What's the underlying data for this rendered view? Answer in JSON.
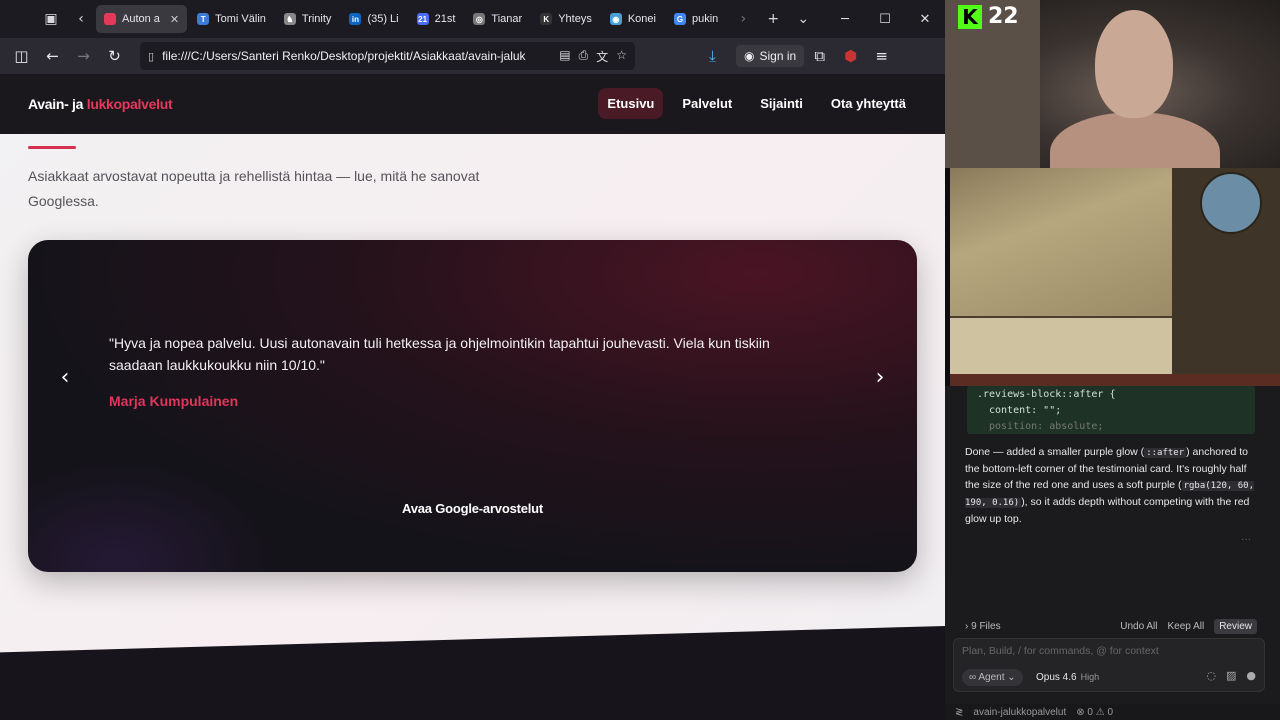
{
  "browser": {
    "tabs": [
      {
        "label": "Auton a",
        "color": "#e33a5c",
        "active": true
      },
      {
        "label": "Tomi Välin",
        "color": "#3a7bd5"
      },
      {
        "label": "Trinity",
        "color": "#888888"
      },
      {
        "label": "(35) Li",
        "color": "#0a66c2"
      },
      {
        "label": "21st",
        "color": "#4a6cf7"
      },
      {
        "label": "Tianar",
        "color": "#777777"
      },
      {
        "label": "Yhteys",
        "color": "#333333"
      },
      {
        "label": "Konei",
        "color": "#4a9fd8"
      },
      {
        "label": "pukin",
        "color": "#4285f4"
      }
    ],
    "tab_favicons": [
      "",
      "T",
      "♞",
      "in",
      "21",
      "◎",
      "K",
      "◉",
      "G"
    ],
    "url": "file:///C:/Users/Santeri Renko/Desktop/projektit/Asiakkaat/avain-jaluk",
    "sign_in": "Sign in"
  },
  "site": {
    "logo_prefix": "Avain- ja ",
    "logo_accent": "lukkopalvelut",
    "nav": [
      {
        "label": "Etusivu",
        "active": true
      },
      {
        "label": "Palvelut"
      },
      {
        "label": "Sijainti"
      },
      {
        "label": "Ota yhteyttä"
      }
    ],
    "lead": "Asiakkaat arvostavat nopeutta ja rehellistä hintaa — lue, mitä he sanovat Googlessa.",
    "review": {
      "quote": "\"Hyva ja nopea palvelu. Uusi autonavain tuli hetkessa ja ohjelmointikin tapahtui jouhevasti. Viela kun tiskiin saadaan laukkukoukku niin 10/10.\"",
      "author": "Marja Kumpulainen",
      "google_button": "Avaa Google-arvostelut"
    }
  },
  "stream": {
    "kick_count": "22"
  },
  "editor": {
    "code_line1": ".reviews-block::after {",
    "code_line2": "content: \"\";",
    "code_line3": "position: absolute;",
    "message_part1": "Done — added a smaller purple glow (",
    "message_code1": "::after",
    "message_part2": ") anchored to the bottom-left corner of the testimonial card. It's roughly half the size of the red one and uses a soft purple (",
    "message_code2": "rgba(120, 60, 190, 0.16)",
    "message_part3": "), so it adds depth without competing with the red glow up top.",
    "files": "9 Files",
    "undo_all": "Undo All",
    "keep_all": "Keep All",
    "review": "Review",
    "placeholder": "Plan, Build, / for commands, @ for context",
    "agent": "Agent",
    "model": "Opus 4.6",
    "effort": "High",
    "project": "avain-jalukkopalvelut",
    "problems": "⊗ 0 ⚠ 0"
  }
}
